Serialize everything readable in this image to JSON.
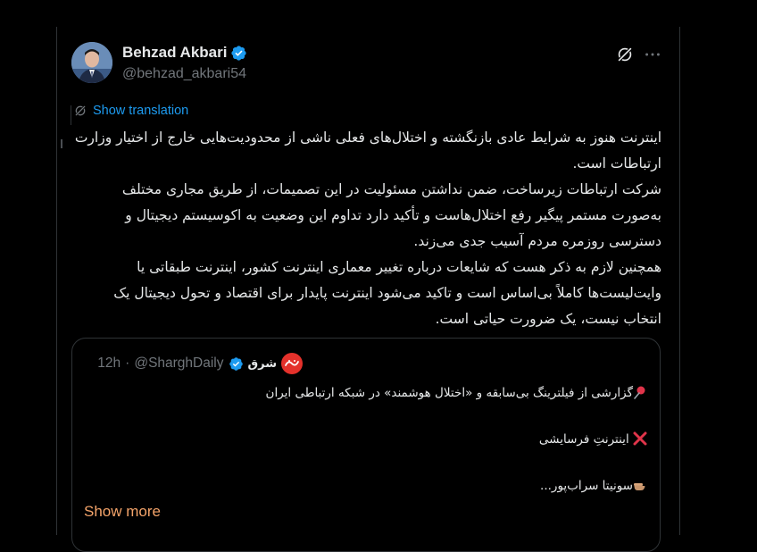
{
  "author": {
    "name": "Behzad Akbari",
    "handle": "@behzad_akbari54",
    "verified": true
  },
  "actions": {
    "grok_icon": "grok-icon",
    "more_icon": "more-icon"
  },
  "translation_link": "Show translation",
  "tweet": {
    "paragraphs": [
      "اینترنت هنوز به شرایط عادی بازنگشته و اختلال‌های فعلی ناشی از محدودیت‌هایی خارج از اختیار وزارت ارتباطات است.",
      "شرکت ارتباطات زیرساخت، ضمن نداشتن مسئولیت در این تصمیمات، از طریق مجاری مختلف به‌صورت مستمر پیگیر رفع اختلال‌هاست و تأکید دارد تداوم این وضعیت به اکوسیستم دیجیتال و دسترسی روزمره مردم آسیب جدی می‌زند.",
      "همچنین لازم به ذکر هست که شایعات درباره تغییر معماری اینترنت کشور، اینترنت طبقاتی یا وایت‌لیست‌ها کاملاً بی‌اساس است و تاکید می‌شود اینترنت پایدار برای اقتصاد و تحول دیجیتال یک انتخاب نیست، یک ضرورت حیاتی است."
    ]
  },
  "quote": {
    "name": "شرق",
    "handle": "@SharghDaily",
    "separator": "·",
    "time": "12h",
    "verified": true,
    "logo_text": "شرق",
    "lines": [
      "گزارشی از فیلترینگ بی‌سابقه و «اختلال هوشمند» در شبکه ارتباطی ایران",
      "اینترنتِ فرسایشی",
      "سونیتا سراب‌پور..."
    ],
    "show_more": "Show more"
  },
  "colors": {
    "background": "#000000",
    "text": "#e7e9ea",
    "muted": "#71767b",
    "link": "#1d9bf0",
    "show_more": "#f4a46a",
    "verified": "#1d9bf0",
    "border": "#2f3336"
  }
}
